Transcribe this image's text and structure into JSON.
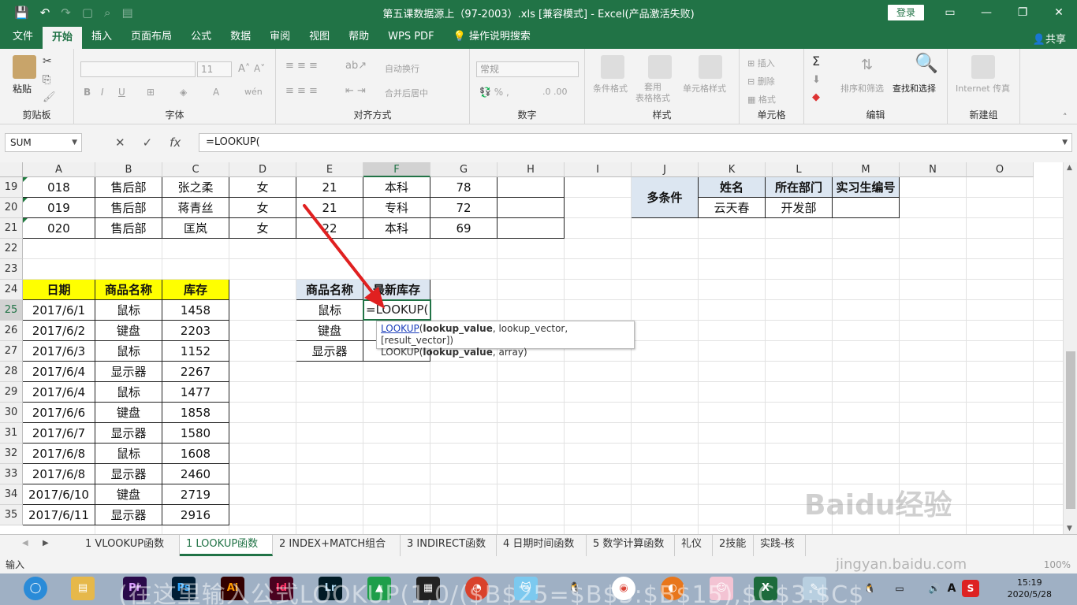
{
  "window": {
    "title": "第五课数据源上（97-2003）.xls  [兼容模式]  -  Excel(产品激活失败)",
    "login_label": "登录"
  },
  "menu": {
    "items": [
      "文件",
      "开始",
      "插入",
      "页面布局",
      "公式",
      "数据",
      "审阅",
      "视图",
      "帮助",
      "WPS PDF",
      "操作说明搜索"
    ],
    "active": "开始",
    "share_label": "共享"
  },
  "ribbon": {
    "groups": [
      "剪贴板",
      "字体",
      "对齐方式",
      "数字",
      "样式",
      "单元格",
      "编辑",
      "新建组"
    ],
    "paste_label": "粘贴",
    "font_size": "11",
    "number_format": "常规",
    "wrap_label": "自动换行",
    "merge_label": "合并后居中",
    "cond_format_label": "条件格式",
    "table_format_label": "套用\n表格格式",
    "cell_style_label": "单元格样式",
    "insert_label": "插入",
    "delete_label": "删除",
    "format_label": "格式",
    "sort_label": "排序和筛选",
    "find_label": "查找和选择",
    "internet_label": "Internet 传真"
  },
  "formula_bar": {
    "name_box": "SUM",
    "formula": "=LOOKUP("
  },
  "columns": [
    "A",
    "B",
    "C",
    "D",
    "E",
    "F",
    "G",
    "H",
    "I",
    "J",
    "K",
    "L",
    "M",
    "N",
    "O"
  ],
  "rows": [
    "19",
    "20",
    "21",
    "22",
    "23",
    "24",
    "25",
    "26",
    "27",
    "28",
    "29",
    "30",
    "31",
    "32",
    "33",
    "34",
    "35"
  ],
  "top_table": [
    [
      "018",
      "售后部",
      "张之柔",
      "女",
      "21",
      "本科",
      "78",
      ""
    ],
    [
      "019",
      "售后部",
      "蒋青丝",
      "女",
      "21",
      "专科",
      "72",
      ""
    ],
    [
      "020",
      "售后部",
      "匡岚",
      "女",
      "22",
      "本科",
      "69",
      ""
    ]
  ],
  "multi_table": {
    "label": "多条件",
    "headers": [
      "姓名",
      "所在部门",
      "实习生编号"
    ],
    "values": [
      "云天春",
      "开发部",
      ""
    ]
  },
  "stock_table": {
    "headers": [
      "日期",
      "商品名称",
      "库存"
    ],
    "rows": [
      [
        "2017/6/1",
        "鼠标",
        "1458"
      ],
      [
        "2017/6/2",
        "键盘",
        "2203"
      ],
      [
        "2017/6/3",
        "鼠标",
        "1152"
      ],
      [
        "2017/6/4",
        "显示器",
        "2267"
      ],
      [
        "2017/6/4",
        "鼠标",
        "1477"
      ],
      [
        "2017/6/6",
        "键盘",
        "1858"
      ],
      [
        "2017/6/7",
        "显示器",
        "1580"
      ],
      [
        "2017/6/8",
        "鼠标",
        "1608"
      ],
      [
        "2017/6/8",
        "显示器",
        "2460"
      ],
      [
        "2017/6/10",
        "键盘",
        "2719"
      ],
      [
        "2017/6/11",
        "显示器",
        "2916"
      ]
    ]
  },
  "lookup_table": {
    "headers": [
      "商品名称",
      "最新库存"
    ],
    "items": [
      "鼠标",
      "键盘",
      "显示器"
    ],
    "active_value": "=LOOKUP("
  },
  "tooltip": {
    "fn": "LOOKUP",
    "line1_arg": "lookup_value",
    "line1_rest": ", lookup_vector, [result_vector])",
    "line2_fn": "LOOKUP(",
    "line2_arg": "lookup_value",
    "line2_rest": ", array)"
  },
  "sheet_tabs": [
    "1 VLOOKUP函数",
    "1 LOOKUP函数",
    "2 INDEX+MATCH组合",
    "3 INDIRECT函数",
    "4 日期时间函数",
    "5 数学计算函数",
    "礼仪",
    "2技能",
    "实践-核"
  ],
  "active_tab": "1 LOOKUP函数",
  "status": {
    "mode": "输入",
    "zoom": "100%"
  },
  "taskbar": {
    "overlay": "(在这里输入公式LOOKUP(1,0/($B$25=$B$3:$B$15),$C$3:$C$",
    "time": "15:19",
    "date": "2020/5/28",
    "apps": [
      "Pr",
      "Ps",
      "Ai",
      "Id",
      "Lr"
    ]
  },
  "watermark": {
    "big": "Baidu经验",
    "small": "jingyan.baidu.com"
  },
  "colors": {
    "excel_green": "#217346",
    "header_yellow": "#ffff00",
    "header_blue": "#dce6f1",
    "arrow_red": "#e02020"
  }
}
